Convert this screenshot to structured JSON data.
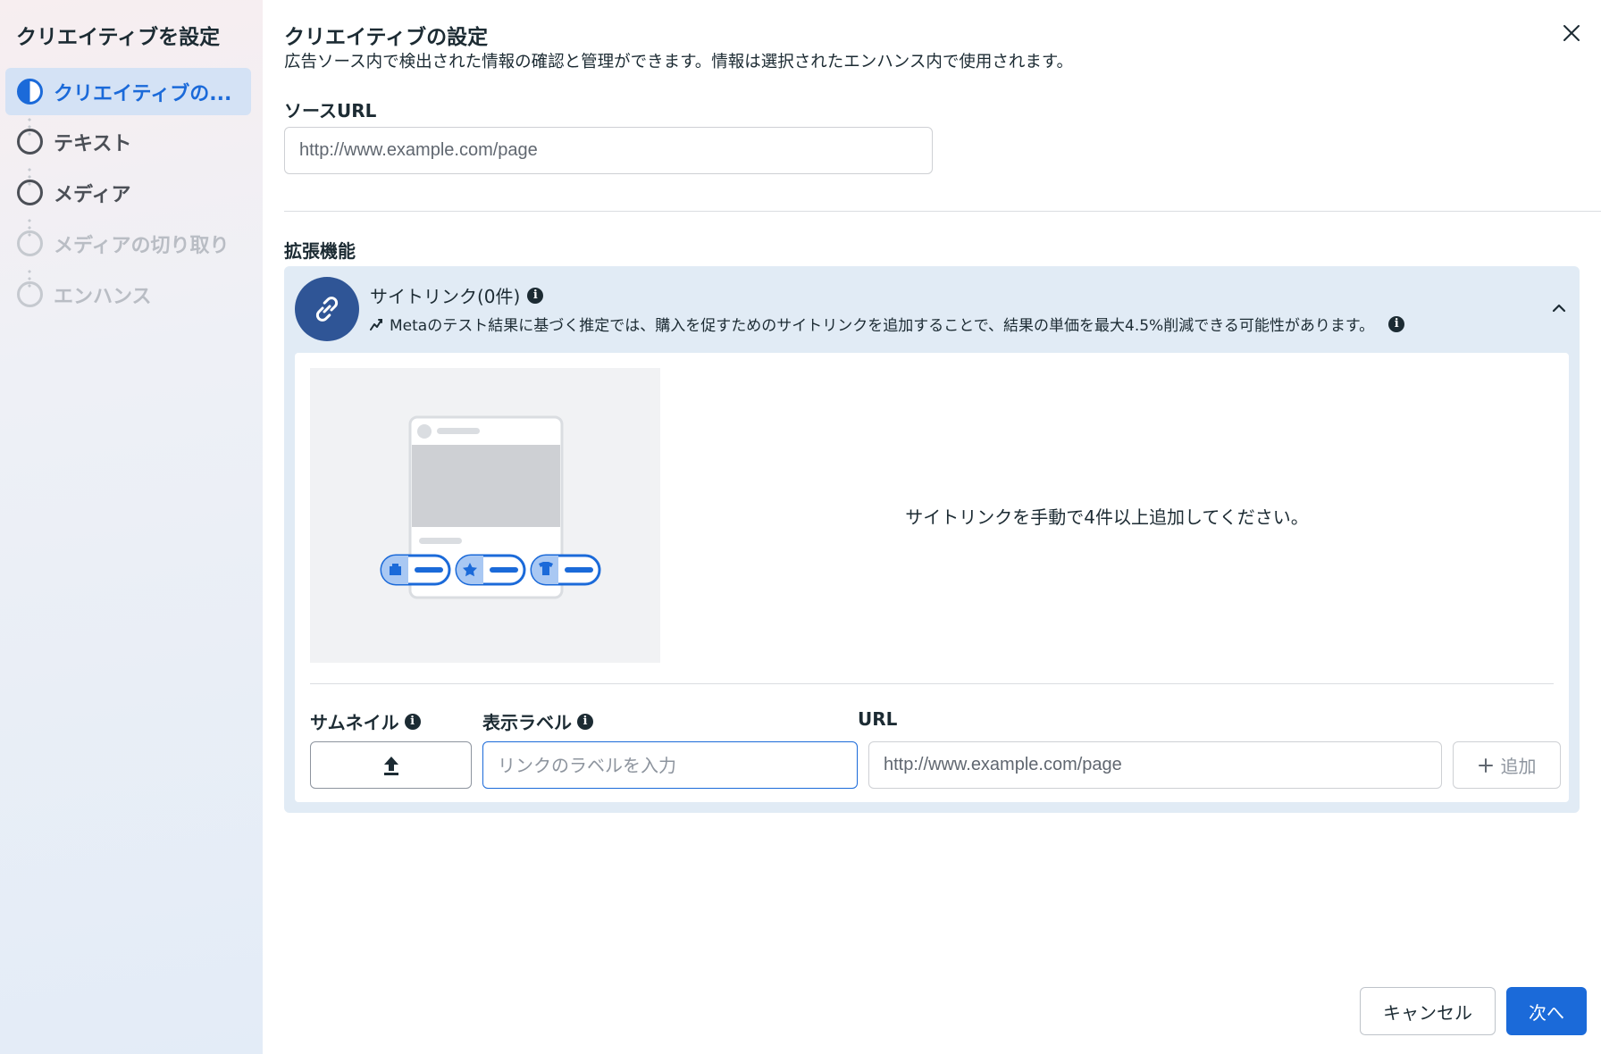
{
  "sidebar": {
    "title": "クリエイティブを設定",
    "steps": [
      {
        "label": "クリエイティブの...",
        "state": "active"
      },
      {
        "label": "テキスト",
        "state": "default"
      },
      {
        "label": "メディア",
        "state": "default"
      },
      {
        "label": "メディアの切り取り",
        "state": "disabled"
      },
      {
        "label": "エンハンス",
        "state": "disabled"
      }
    ]
  },
  "header": {
    "title": "クリエイティブの設定",
    "description": "広告ソース内で検出された情報の確認と管理ができます。情報は選択されたエンハンス内で使用されます。"
  },
  "source_url": {
    "label": "ソースURL",
    "placeholder": "http://www.example.com/page"
  },
  "extensions": {
    "label": "拡張機能",
    "sitelinks": {
      "title": "サイトリンク(0件)",
      "recommendation": "Metaのテスト結果に基づく推定では、購入を促すためのサイトリンクを追加することで、結果の単価を最大4.5%削減できる可能性があります。",
      "empty_message": "サイトリンクを手動で4件以上追加してください。",
      "thumbnail_label": "サムネイル",
      "display_label": "表示ラベル",
      "display_placeholder": "リンクのラベルを入力",
      "url_label": "URL",
      "url_placeholder": "http://www.example.com/page",
      "add_label": "追加"
    }
  },
  "footer": {
    "cancel_label": "キャンセル",
    "next_label": "次へ"
  },
  "colors": {
    "accent": "#1b6ad9",
    "panel_bg": "#e1ebf5",
    "icon_bg": "#2f5596"
  }
}
